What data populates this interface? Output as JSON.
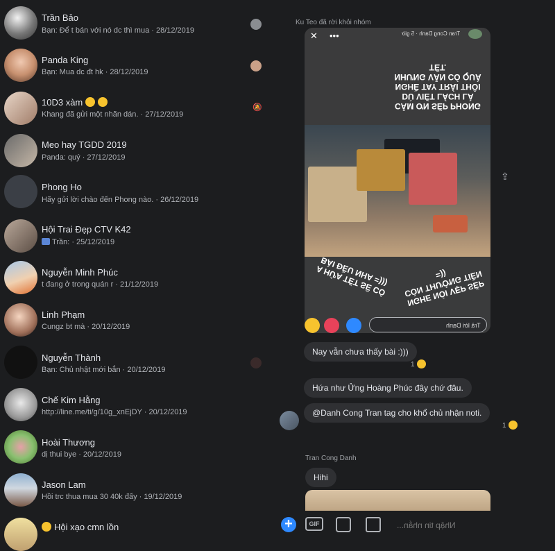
{
  "conversations": [
    {
      "name": "Trần Bảo",
      "preview": "Bạn: Để t bán với nó dc thì mua · 28/12/2019"
    },
    {
      "name": "Panda King",
      "preview": "Bạn: Mua dc đt hk · 28/12/2019"
    },
    {
      "name": "10D3 xàm",
      "preview": "Khang đã gửi một nhãn dán. · 27/12/2019"
    },
    {
      "name": "Meo hay TGDD 2019",
      "preview": "Panda: quý · 27/12/2019"
    },
    {
      "name": "Phong Ho",
      "preview": "Hãy gửi lời chào đến Phong nào. · 26/12/2019"
    },
    {
      "name": "Hội Trai Đẹp CTV K42",
      "preview": "Trần: · 25/12/2019"
    },
    {
      "name": "Nguyễn Minh Phúc",
      "preview": "t đang ở trong quán r · 21/12/2019"
    },
    {
      "name": "Linh Phạm",
      "preview": "Cungz bt mà · 20/12/2019"
    },
    {
      "name": "Nguyễn Thành",
      "preview": "Bạn: Chủ nhật mới bắn · 20/12/2019"
    },
    {
      "name": "Chế Kim Hằng",
      "preview": "http://line.me/ti/g/10g_xnEjDY · 20/12/2019"
    },
    {
      "name": "Hoài Thương",
      "preview": "dị thui bye · 20/12/2019"
    },
    {
      "name": "Jason Lam",
      "preview": "Hồi trc thua mua 30 40k đấy · 19/12/2019"
    },
    {
      "name": "Hội xạo cmn lồn",
      "preview": ""
    }
  ],
  "chat": {
    "system_note": "Ku Teo đã rời khỏi nhóm",
    "story": {
      "header": "Tran Cong Danh · 5 giờ",
      "top_text": "CẢM ƠN SẾP PHONG DÙ VIẾT LÁCH LÀ NGHỀ TAY TRÁI THÔI NHƯNG VẪN CÓ QUÀ TẾT.",
      "bottom_left": "A HỨA TẾT SẼ CÓ BÀI ĐỀU NHA =)))",
      "bottom_right": "NGHE NÓI VẸP SẾP CÒN THƯỞNG TIỀN =))",
      "reply_placeholder": "Trả lời Danh"
    },
    "messages": [
      {
        "text": "Nay vẫn chưa thấy bài :)))",
        "react_count": "1"
      },
      {
        "text": "Hứa như Ửng Hoàng Phúc đây chứ đâu."
      },
      {
        "text": "@Danh Cong Tran tag cho khổ chủ nhận noti.",
        "react_count": "1"
      }
    ],
    "sender_name": "Tran Cong Danh",
    "last_message": "Hihi"
  },
  "composer": {
    "gif_label": "GIF",
    "placeholder": "Nhập tin nhắn..."
  },
  "colors": {
    "accent": "#2e89ff",
    "background": "#1c1d1f",
    "bubble": "#2f3033"
  }
}
